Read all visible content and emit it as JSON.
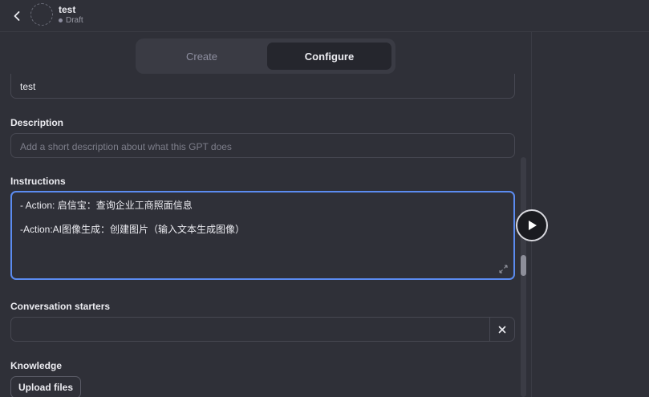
{
  "header": {
    "gpt_name": "test",
    "status": "Draft"
  },
  "tabs": [
    {
      "label": "Create",
      "active": false
    },
    {
      "label": "Configure",
      "active": true
    }
  ],
  "form": {
    "name_value": "test",
    "description_label": "Description",
    "description_placeholder": "Add a short description about what this GPT does",
    "instructions_label": "Instructions",
    "instructions_lines": [
      "- Action: 启信宝：查询企业工商照面信息",
      "",
      "-Action:AI图像生成：创建图片（输入文本生成图像）"
    ],
    "starters_label": "Conversation starters",
    "starter_value": "",
    "knowledge_label": "Knowledge",
    "upload_label": "Upload files"
  },
  "colors": {
    "background": "#2f3038",
    "focus_border": "#5b8bf0",
    "active_tab": "#25262d"
  },
  "icons": {
    "back": "chevron-left-icon",
    "clear": "close-icon",
    "resize": "resize-handle-icon",
    "play": "play-icon"
  }
}
